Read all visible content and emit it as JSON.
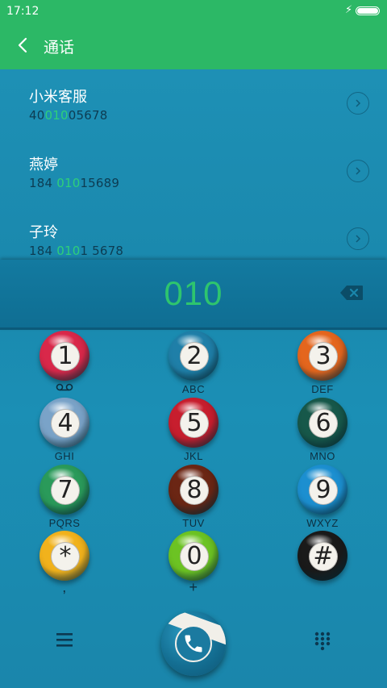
{
  "status_bar": {
    "time": "17:12",
    "battery_level": 1.0
  },
  "header": {
    "title": "通话"
  },
  "contacts": [
    {
      "name": "小米客服",
      "number_before": "40",
      "number_match": "010",
      "number_after": "05678"
    },
    {
      "name": "燕婷",
      "number_before": "184 ",
      "number_match": "010",
      "number_after": "15689"
    },
    {
      "name": "子玲",
      "number_before": "184 ",
      "number_match": "010",
      "number_after": "1 5678"
    }
  ],
  "input": {
    "digits": "010"
  },
  "keypad": [
    {
      "digit": "1",
      "letters": "voicemail-icon",
      "color": "#d9284a"
    },
    {
      "digit": "2",
      "letters": "ABC",
      "color": "#1f7fa8"
    },
    {
      "digit": "3",
      "letters": "DEF",
      "color": "#e4661e"
    },
    {
      "digit": "4",
      "letters": "GHI",
      "color": "#7aa3c8"
    },
    {
      "digit": "5",
      "letters": "JKL",
      "color": "#c71e2e"
    },
    {
      "digit": "6",
      "letters": "MNO",
      "color": "#17584a"
    },
    {
      "digit": "7",
      "letters": "PQRS",
      "color": "#2a9a5a"
    },
    {
      "digit": "8",
      "letters": "TUV",
      "color": "#6b2614"
    },
    {
      "digit": "9",
      "letters": "WXYZ",
      "color": "#1c8fd0"
    },
    {
      "digit": "*",
      "letters": ",",
      "color": "#f1b21c"
    },
    {
      "digit": "0",
      "letters": "+",
      "color": "#6cc323"
    },
    {
      "digit": "#",
      "letters": "",
      "color": "#1a1a1a"
    }
  ],
  "colors": {
    "header": "#2cb866",
    "match_highlight": "#2ed07a",
    "digits": "#2ec56e"
  },
  "icons": {
    "menu": "menu-icon",
    "call": "phone-icon",
    "dialpad": "dialpad-icon",
    "back": "back-arrow-icon",
    "backspace": "backspace-icon"
  }
}
